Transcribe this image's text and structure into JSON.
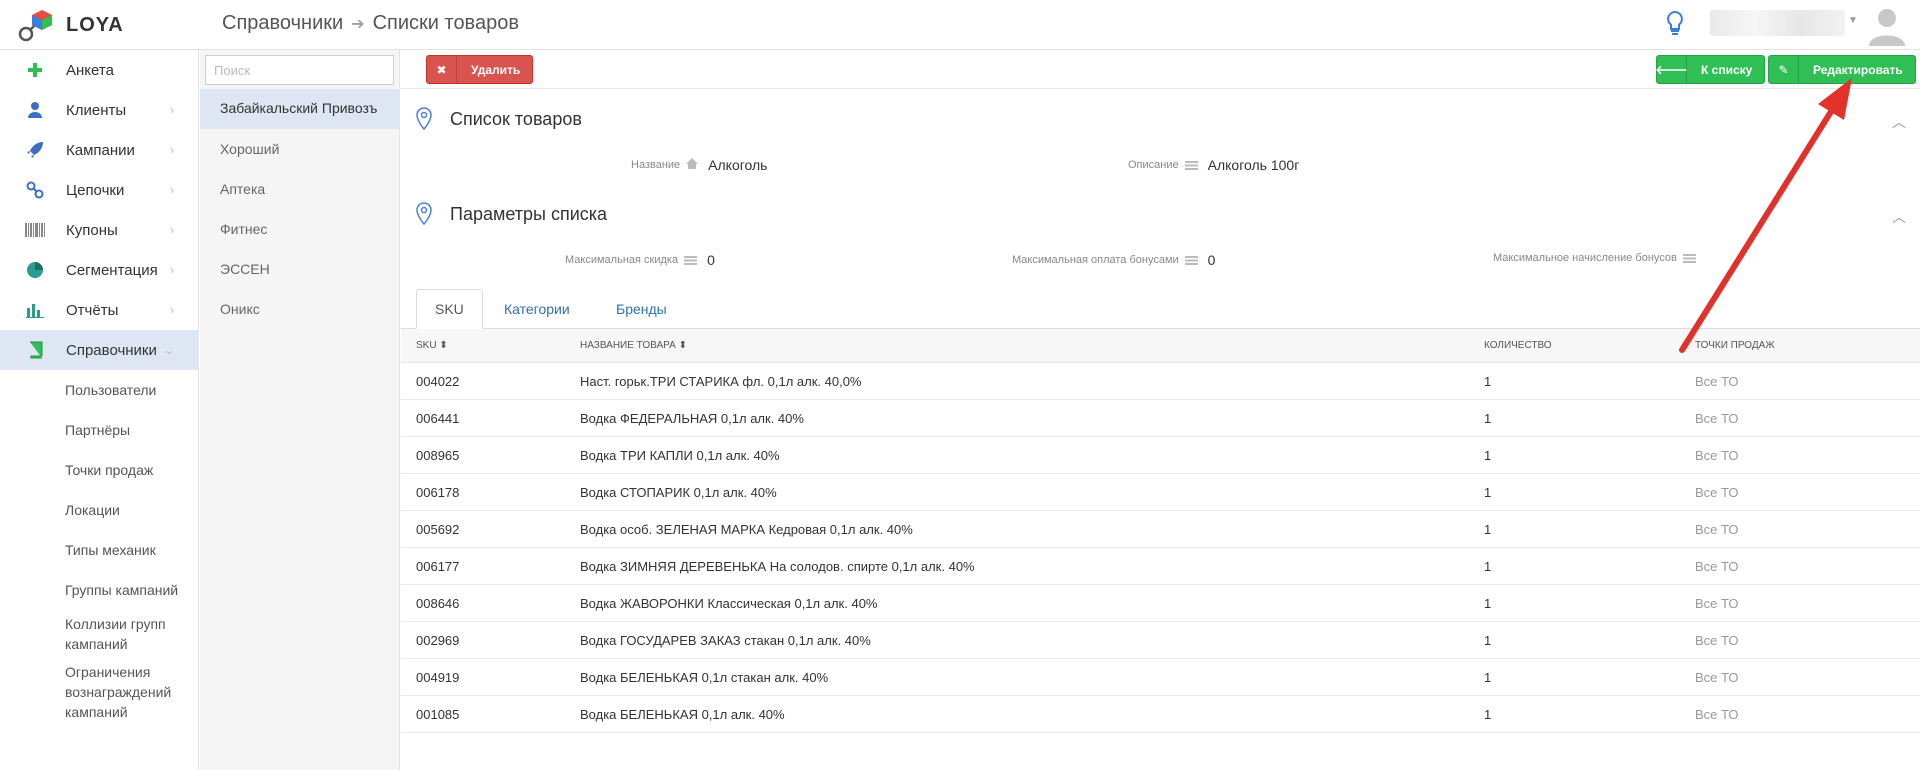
{
  "app": {
    "name": "LOYA"
  },
  "header": {
    "breadcrumb": [
      "Справочники",
      "Списки товаров"
    ]
  },
  "nav": {
    "items": [
      {
        "label": "Анкета",
        "icon": "plus-icon",
        "chevron": false
      },
      {
        "label": "Клиенты",
        "icon": "user-icon",
        "chevron": true
      },
      {
        "label": "Кампании",
        "icon": "rocket-icon",
        "chevron": true
      },
      {
        "label": "Цепочки",
        "icon": "link-icon",
        "chevron": true
      },
      {
        "label": "Купоны",
        "icon": "barcode-icon",
        "chevron": true
      },
      {
        "label": "Сегментация",
        "icon": "pie-chart-icon",
        "chevron": true
      },
      {
        "label": "Отчёты",
        "icon": "bar-chart-icon",
        "chevron": true
      },
      {
        "label": "Справочники",
        "icon": "book-icon",
        "chevron": true,
        "active": true
      }
    ],
    "subitems": [
      "Пользователи",
      "Партнёры",
      "Точки продаж",
      "Локации",
      "Типы механик",
      "Группы кампаний",
      "Коллизии групп кампаний",
      "Ограничения вознаграждений кампаний"
    ]
  },
  "list": {
    "search_placeholder": "Поиск",
    "items": [
      "Забайкальский Привозъ",
      "Хороший",
      "Аптека",
      "Фитнес",
      "ЭССЕН",
      "Оникс"
    ]
  },
  "toolbar": {
    "delete_label": "Удалить",
    "back_label": "К списку",
    "edit_label": "Редактировать"
  },
  "section1": {
    "title": "Список товаров",
    "name_label": "Название",
    "name_value": "Алкоголь",
    "desc_label": "Описание",
    "desc_value": "Алкоголь 100г"
  },
  "section2": {
    "title": "Параметры списка",
    "max_discount_label": "Максимальная скидка",
    "max_discount_value": "0",
    "max_bonus_pay_label": "Максимальная оплата бонусами",
    "max_bonus_pay_value": "0",
    "max_bonus_accrual_label": "Максимальное начисление бонусов",
    "max_bonus_accrual_value": ""
  },
  "tabs": [
    "SKU",
    "Категории",
    "Бренды"
  ],
  "table": {
    "headers": [
      "SKU ⬍",
      "НАЗВАНИЕ ТОВАРА ⬍",
      "КОЛИЧЕСТВО",
      "ТОЧКИ ПРОДАЖ"
    ],
    "rows": [
      [
        "004022",
        "Наст. горьк.ТРИ СТАРИКА фл. 0,1л алк. 40,0%",
        "1",
        "Все ТО"
      ],
      [
        "006441",
        "Водка ФЕДЕРАЛЬНАЯ 0,1л алк. 40%",
        "1",
        "Все ТО"
      ],
      [
        "008965",
        "Водка ТРИ КАПЛИ 0,1л алк. 40%",
        "1",
        "Все ТО"
      ],
      [
        "006178",
        "Водка СТОПАРИК 0,1л алк. 40%",
        "1",
        "Все ТО"
      ],
      [
        "005692",
        "Водка особ. ЗЕЛЕНАЯ МАРКА Кедровая 0,1л алк. 40%",
        "1",
        "Все ТО"
      ],
      [
        "006177",
        "Водка ЗИМНЯЯ ДЕРЕВЕНЬКА На солодов. спирте 0,1л алк. 40%",
        "1",
        "Все ТО"
      ],
      [
        "008646",
        "Водка ЖАВОРОНКИ Классическая 0,1л алк. 40%",
        "1",
        "Все ТО"
      ],
      [
        "002969",
        "Водка ГОСУДАРЕВ ЗАКАЗ стакан 0,1л алк. 40%",
        "1",
        "Все ТО"
      ],
      [
        "004919",
        "Водка БЕЛЕНЬКАЯ 0,1л стакан алк. 40%",
        "1",
        "Все ТО"
      ],
      [
        "001085",
        "Водка БЕЛЕНЬКАЯ 0,1л алк. 40%",
        "1",
        "Все ТО"
      ]
    ]
  },
  "colors": {
    "accent_green": "#2fbf55",
    "danger_red": "#d9534f",
    "active_bg": "#dfe6f3",
    "annotation_arrow": "#e0312b"
  }
}
